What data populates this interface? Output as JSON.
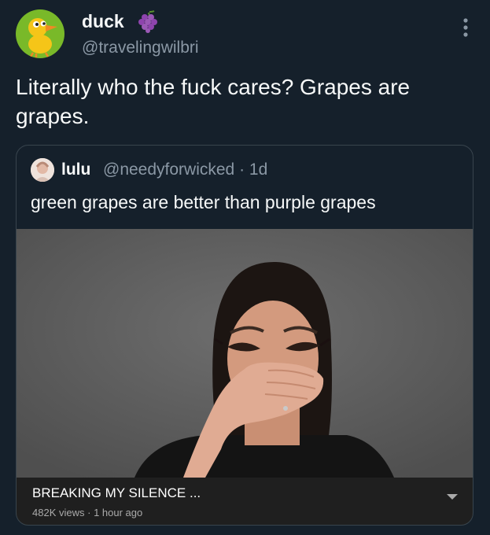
{
  "tweet": {
    "author_name": "duck",
    "author_handle": "@travelingwilbri",
    "text": "Literally who the fuck cares? Grapes are grapes.",
    "name_emoji": "grapes-icon"
  },
  "quote": {
    "author_name": "lulu",
    "author_handle": "@needyforwicked",
    "separator": "·",
    "age": "1d",
    "text": "green grapes are better than purple grapes"
  },
  "video": {
    "title": "BREAKING MY SILENCE ...",
    "views": "482K views",
    "separator": "·",
    "age": "1 hour ago"
  },
  "colors": {
    "background": "#15202b",
    "text_primary": "#f7f9f9",
    "text_secondary": "#8b98a5",
    "card_border": "#38444d",
    "avatar_bg": "#79b929",
    "video_bar_bg": "#1f1f1f"
  }
}
